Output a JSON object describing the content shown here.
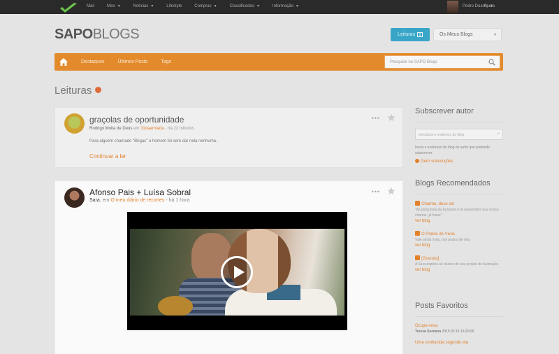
{
  "topbar": {
    "nav": [
      {
        "label": "Mail",
        "caret": false
      },
      {
        "label": "Meo",
        "caret": true
      },
      {
        "label": "Notícias",
        "caret": true
      },
      {
        "label": "Lifestyle",
        "caret": false
      },
      {
        "label": "Compras",
        "caret": true
      },
      {
        "label": "Classificados",
        "caret": true
      },
      {
        "label": "Informação",
        "caret": true
      }
    ],
    "help": "Ajuda",
    "user": "Pedro Duarte"
  },
  "brand": {
    "bold": "SAPO",
    "thin": "BLOGS"
  },
  "header": {
    "leituras_label": "Leituras",
    "blogs_label": "Os Meus Blogs"
  },
  "orange_nav": {
    "items": [
      "Destaques",
      "Últimos Posts",
      "Tags"
    ],
    "search_placeholder": "Pesquise no SAPO Blogs"
  },
  "page": {
    "title": "Leituras"
  },
  "posts": [
    {
      "title": "graçolas de oportunidade",
      "author": "Rodrigo Moita de Deus",
      "in": "em",
      "blog": "31daarmada",
      "time": "- há 22 minutos",
      "excerpt": "Para alguém chamado \"Brigas\" o homem foi sem dar nela nenhuma.",
      "more": "Continuar a ler"
    },
    {
      "title": "Afonso Pais + Luísa Sobral",
      "author": "Sara",
      "in": ", em",
      "blog": "O meu diário de recortes",
      "time": "- há 1 hora"
    }
  ],
  "sidebar": {
    "subscribe": {
      "title": "Subscrever autor",
      "placeholder": "Introduza o endereço do blog",
      "help": "Insira o endereço do blog do autor que pretende subscrever.",
      "link": "Gerir subscrições"
    },
    "recommended": {
      "title": "Blogs Recomendados",
      "items": [
        {
          "name": "Charme, deus sei",
          "excerpt": "\"As perguntas da tal tarefa e té respondem que nosso charme, já fosse\"",
          "more": "ver blog"
        },
        {
          "name": "O Pratos de Vivos",
          "excerpt": "Vale ainda mais, nos pratos de vida",
          "more": "ver blog"
        },
        {
          "name": "[Gravura]",
          "excerpt": "A Sara explora os relatos de seu projeto de ilustração.",
          "more": "ver blog"
        }
      ]
    },
    "favorites": {
      "title": "Posts Favoritos",
      "items": [
        {
          "title": "Ocupa nova",
          "author": "Teresa Soreano",
          "date": "2015.02.16 16:20:00"
        },
        {
          "title": "Uma conhecida segundo ela",
          "author": "",
          "date": ""
        }
      ]
    }
  }
}
